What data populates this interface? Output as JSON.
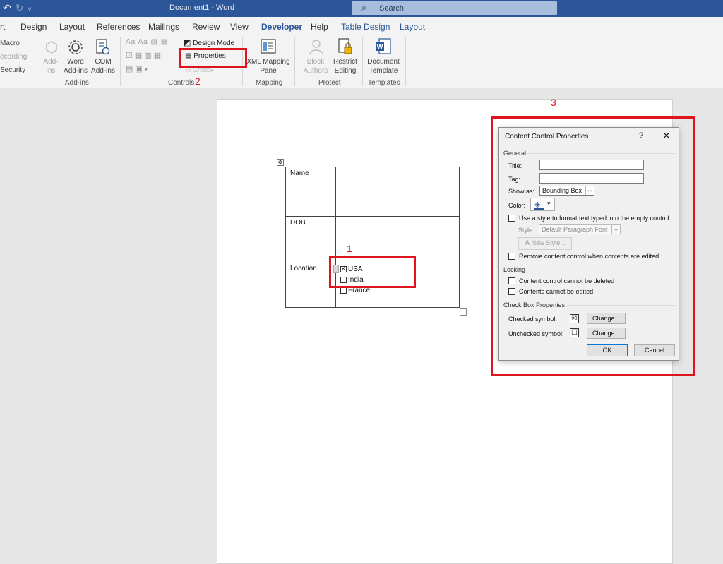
{
  "title_bar": {
    "document_title": "Document1  -  Word",
    "search_icon": "search-icon",
    "search_label": "Search",
    "quick_access": [
      "undo-icon",
      "redo-icon",
      "customize-icon"
    ]
  },
  "tabs": [
    {
      "label": "rt",
      "state": "normal"
    },
    {
      "label": "Design",
      "state": "normal"
    },
    {
      "label": "Layout",
      "state": "normal"
    },
    {
      "label": "References",
      "state": "normal"
    },
    {
      "label": "Mailings",
      "state": "normal"
    },
    {
      "label": "Review",
      "state": "normal"
    },
    {
      "label": "View",
      "state": "normal"
    },
    {
      "label": "Developer",
      "state": "active"
    },
    {
      "label": "Help",
      "state": "normal"
    },
    {
      "label": "Table Design",
      "state": "contextual"
    },
    {
      "label": "Layout",
      "state": "contextual"
    }
  ],
  "ribbon": {
    "code": {
      "macro": "Macro",
      "recording": "ecording",
      "security": "Security"
    },
    "addins": {
      "addins_label": "Add-\nins",
      "word_addins": "Word\nAdd-ins",
      "com_addins": "COM\nAdd-ins",
      "group": "Add-ins"
    },
    "controls": {
      "design_mode": "Design Mode",
      "properties": "Properties",
      "group_btn": "Group",
      "group": "Controls",
      "annotation": "2"
    },
    "mapping": {
      "xml_mapping": "XML Mapping\nPane",
      "group": "Mapping"
    },
    "protect": {
      "block_authors": "Block\nAuthors",
      "restrict_editing": "Restrict\nEditing",
      "group": "Protect"
    },
    "templates": {
      "document_template": "Document\nTemplate",
      "group": "Templates"
    }
  },
  "document": {
    "table": {
      "rows": [
        {
          "label": "Name"
        },
        {
          "label": "DOB"
        },
        {
          "label": "Location"
        }
      ],
      "checkboxes": [
        {
          "label": "USA",
          "checked": true
        },
        {
          "label": "India",
          "checked": false
        },
        {
          "label": "France",
          "checked": false
        }
      ]
    },
    "annotation_1": "1",
    "annotation_3": "3"
  },
  "dialog": {
    "title": "Content Control Properties",
    "help": "?",
    "close": "✕",
    "general": "General",
    "title_label": "Title:",
    "tag_label": "Tag:",
    "title_value": "",
    "tag_value": "",
    "show_as_label": "Show as:",
    "show_as_value": "Bounding Box",
    "color_label": "Color:",
    "use_style_text": "Use a style to format text typed into the empty control",
    "style_label": "Style:",
    "style_value": "Default Paragraph Font",
    "new_style": "New Style...",
    "remove_text": "Remove content control when contents are edited",
    "locking": "Locking",
    "lock_delete": "Content control cannot be deleted",
    "lock_edit": "Contents cannot be edited",
    "checkbox_props": "Check Box Properties",
    "checked_symbol_label": "Checked symbol:",
    "unchecked_symbol_label": "Unchecked symbol:",
    "checked_symbol": "☒",
    "unchecked_symbol": "☐",
    "change1": "Change...",
    "change2": "Change...",
    "ok": "OK",
    "cancel": "Cancel"
  },
  "colors": {
    "accent": "#2b579a",
    "annotation": "#e0141e"
  }
}
